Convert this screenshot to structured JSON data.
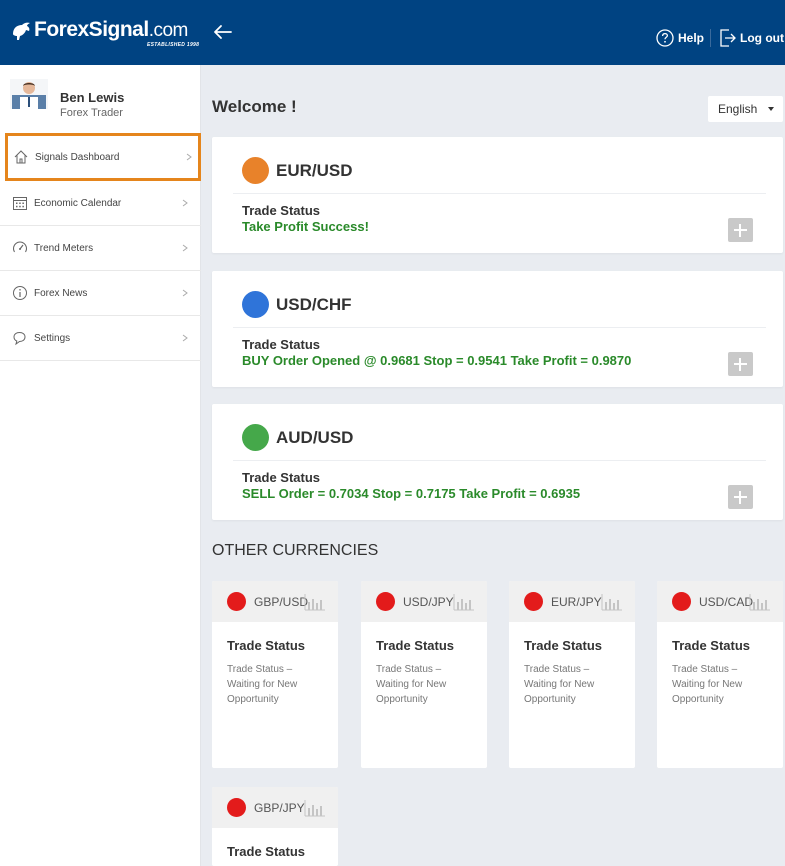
{
  "header": {
    "logo_text": "ForexSignal",
    "logo_suffix": ".com",
    "logo_tagline": "ESTABLISHED 1998",
    "help_label": "Help",
    "logout_label": "Log out",
    "bg_color": "#004382"
  },
  "user": {
    "name": "Ben Lewis",
    "role": "Forex Trader"
  },
  "sidebar": {
    "items": [
      {
        "label": "Signals Dashboard",
        "icon": "home-icon",
        "active": true
      },
      {
        "label": "Economic Calendar",
        "icon": "calendar-icon",
        "active": false
      },
      {
        "label": "Trend Meters",
        "icon": "gauge-icon",
        "active": false
      },
      {
        "label": "Forex News",
        "icon": "info-icon",
        "active": false
      },
      {
        "label": "Settings",
        "icon": "chat-icon",
        "active": false
      }
    ],
    "active_outline_color": "#e5851c"
  },
  "main": {
    "welcome": "Welcome !",
    "language": "English"
  },
  "signals": [
    {
      "pair": "EUR/USD",
      "dot_color": "#e8822a",
      "status_label": "Trade Status",
      "status_value": "Take Profit Success!"
    },
    {
      "pair": "USD/CHF",
      "dot_color": "#2f74d9",
      "status_label": "Trade Status",
      "status_value": "BUY Order Opened @ 0.9681 Stop = 0.9541 Take Profit = 0.9870"
    },
    {
      "pair": "AUD/USD",
      "dot_color": "#45a84a",
      "status_label": "Trade Status",
      "status_value": "SELL Order = 0.7034 Stop = 0.7175 Take Profit = 0.6935"
    }
  ],
  "status_value_color": "#2a8a2a",
  "other": {
    "title": "OTHER CURRENCIES",
    "dot_color": "#e31b1b",
    "items": [
      {
        "pair": "GBP/USD",
        "status_label": "Trade Status",
        "status_desc": "Trade Status – Waiting for New Opportunity"
      },
      {
        "pair": "USD/JPY",
        "status_label": "Trade Status",
        "status_desc": "Trade Status – Waiting for New Opportunity"
      },
      {
        "pair": "EUR/JPY",
        "status_label": "Trade Status",
        "status_desc": "Trade Status – Waiting for New Opportunity"
      },
      {
        "pair": "USD/CAD",
        "status_label": "Trade Status",
        "status_desc": "Trade Status – Waiting for New Opportunity"
      },
      {
        "pair": "GBP/JPY",
        "status_label": "Trade Status",
        "status_desc": ""
      }
    ]
  }
}
